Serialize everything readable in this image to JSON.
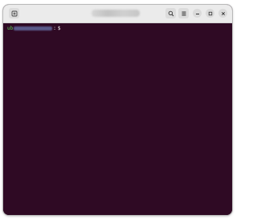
{
  "terminal": {
    "prompt_user": "ub",
    "prompt_separator": ":",
    "prompt_symbol": "$"
  },
  "titlebar": {
    "icons": [
      "new-tab-icon",
      "search-icon",
      "menu-icon",
      "minimize-icon",
      "maximize-icon",
      "close-icon"
    ]
  },
  "colors": {
    "terminal_bg": "#2f0a24",
    "titlebar_bg": "#ebebeb",
    "prompt_user": "#5fd35f"
  }
}
